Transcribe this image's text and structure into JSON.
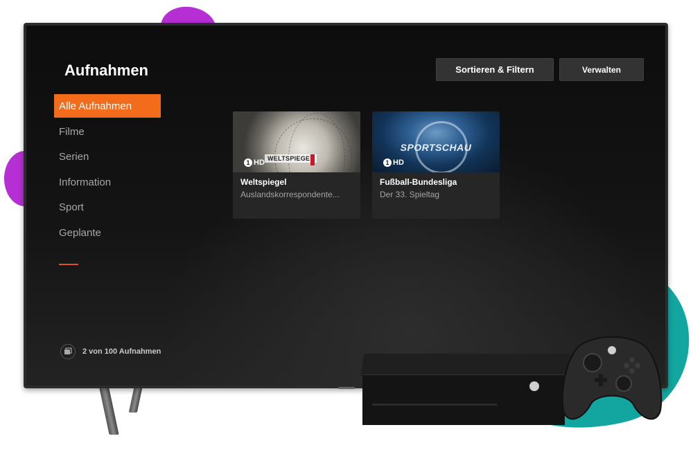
{
  "header": {
    "title": "Aufnahmen",
    "sort_filter_label": "Sortieren & Filtern",
    "manage_label": "Verwalten"
  },
  "sidebar": {
    "items": [
      {
        "label": "Alle Aufnahmen",
        "active": true
      },
      {
        "label": "Filme",
        "active": false
      },
      {
        "label": "Serien",
        "active": false
      },
      {
        "label": "Information",
        "active": false
      },
      {
        "label": "Sport",
        "active": false
      },
      {
        "label": "Geplante",
        "active": false
      }
    ]
  },
  "recordings": [
    {
      "channel": "HD",
      "title": "Weltspiegel",
      "subtitle": "Auslandskorrespondente...",
      "thumb_text": "WELTSPIEGEL"
    },
    {
      "channel": "HD",
      "title": "Fußball-Bundesliga",
      "subtitle": "Der 33. Spieltag",
      "thumb_text": "SPORTSCHAU"
    }
  ],
  "footer": {
    "count_text": "2 von 100 Aufnahmen"
  },
  "colors": {
    "accent": "#f36c1b",
    "screen_bg": "#121212",
    "teal_blob": "#13a6a0",
    "purple_blob": "#b62fd4"
  }
}
